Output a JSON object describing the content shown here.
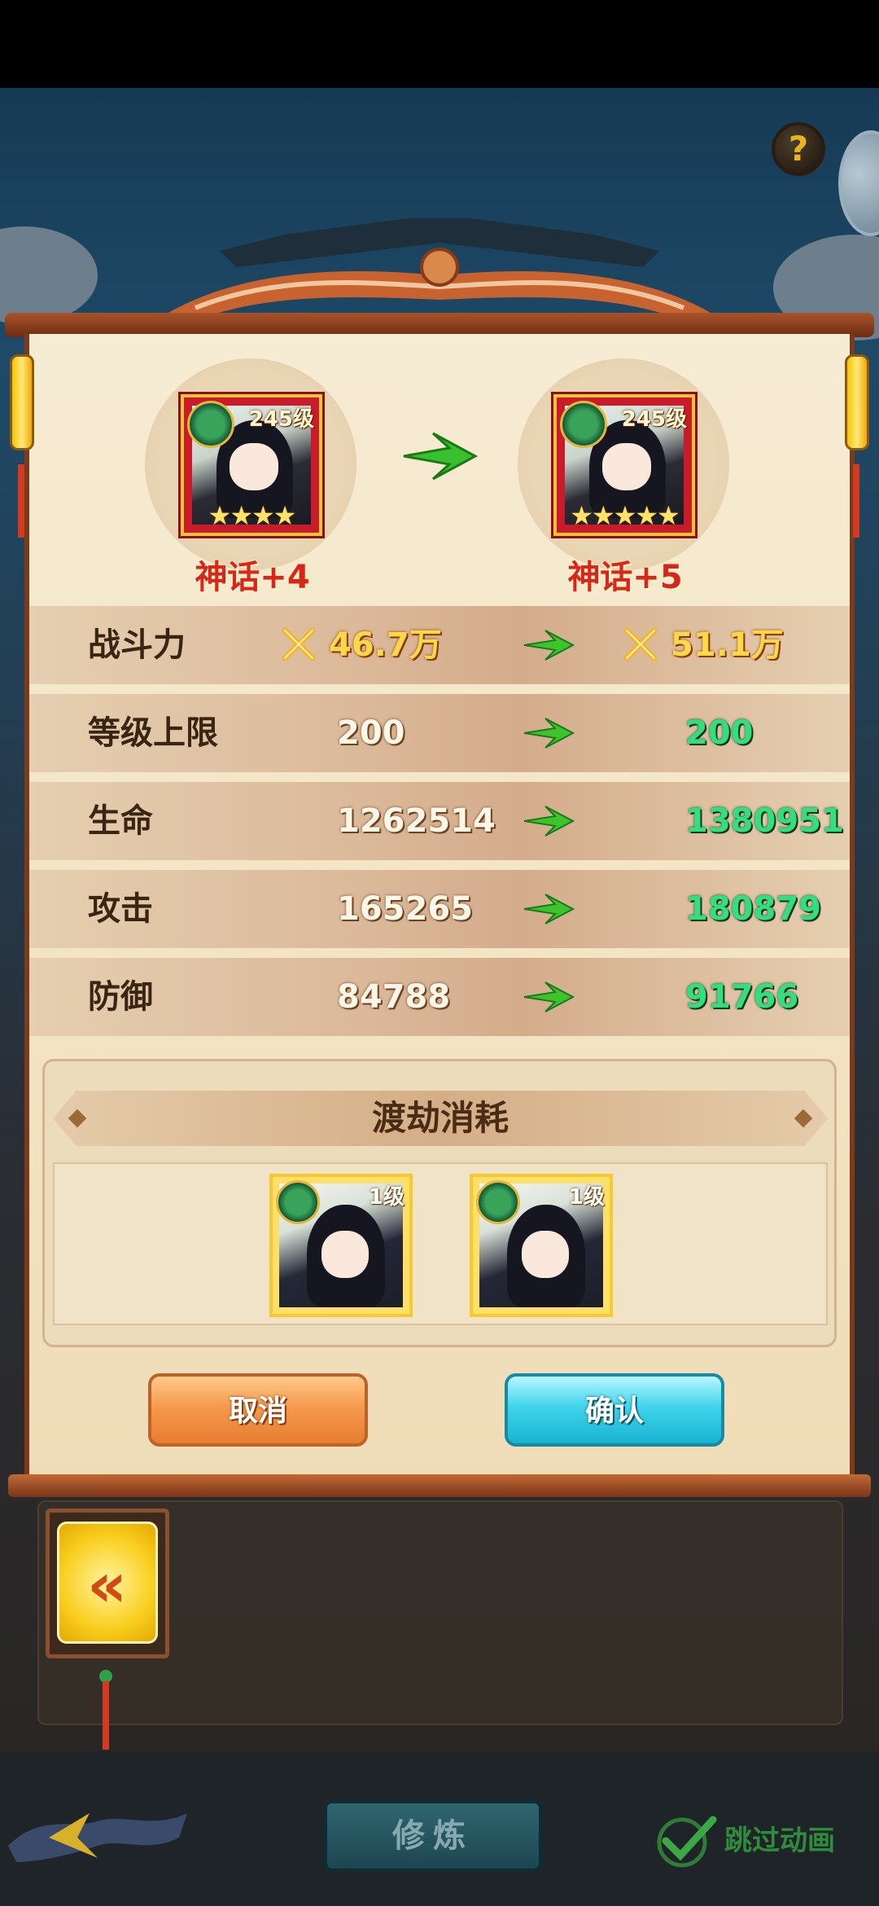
{
  "hero_before": {
    "level": "245级",
    "stars": "★★★★",
    "name": "神话+4"
  },
  "hero_after": {
    "level": "245级",
    "stars": "★★★★★",
    "name": "神话+5"
  },
  "stats": [
    {
      "label": "战斗力",
      "old": "46.7万",
      "new": "51.1万"
    },
    {
      "label": "等级上限",
      "old": "200",
      "new": "200"
    },
    {
      "label": "生命",
      "old": "1262514",
      "new": "1380951"
    },
    {
      "label": "攻击",
      "old": "165265",
      "new": "180879"
    },
    {
      "label": "防御",
      "old": "84788",
      "new": "91766"
    }
  ],
  "cost": {
    "title": "渡劫消耗",
    "items": [
      {
        "level": "1级"
      },
      {
        "level": "1级"
      }
    ]
  },
  "buttons": {
    "cancel": "取消",
    "confirm": "确认"
  },
  "bottom": {
    "train": "修炼",
    "skip": "跳过动画",
    "help": "?"
  },
  "icons": {
    "help": "question-mark-icon",
    "arrow": "green-arrow-icon",
    "power": "crossed-swords-icon",
    "back": "back-chevron-icon",
    "skip": "checkmark-icon"
  },
  "colors": {
    "name_red": "#d7261a",
    "new_value_green": "#31e07c",
    "power_gold": "#ffd84a",
    "cancel_orange": "#f59a4e",
    "confirm_cyan": "#40d4ec"
  }
}
